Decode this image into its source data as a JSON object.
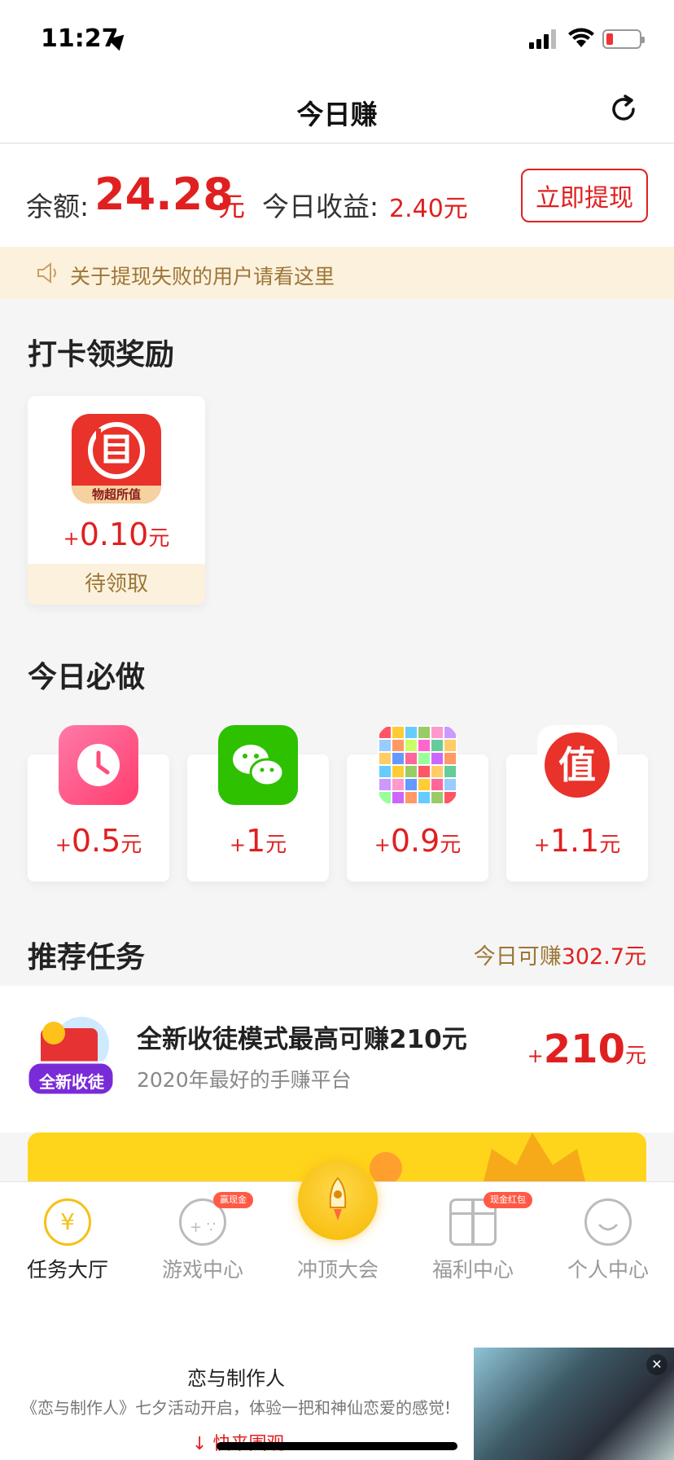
{
  "status_bar": {
    "time": "11:27"
  },
  "nav": {
    "title": "今日赚"
  },
  "balance": {
    "label": "余额:",
    "value": "24.28",
    "unit": "元",
    "today_label": "今日收益:",
    "today_value": "2.40元",
    "withdraw_label": "立即提现"
  },
  "notice": {
    "text": "关于提现失败的用户请看这里"
  },
  "checkin": {
    "title": "打卡领奖励",
    "card": {
      "badge": "物超所值",
      "plus": "+",
      "amount": "0.10",
      "unit": "元",
      "status": "待领取"
    }
  },
  "daily": {
    "title": "今日必做",
    "tasks": [
      {
        "icon": "clock-icon",
        "plus": "+",
        "amount": "0.5",
        "unit": "元"
      },
      {
        "icon": "wechat-icon",
        "plus": "+",
        "amount": "1",
        "unit": "元"
      },
      {
        "icon": "color-grid-icon",
        "plus": "+",
        "amount": "0.9",
        "unit": "元"
      },
      {
        "icon": "zhi-icon",
        "glyph": "值",
        "plus": "+",
        "amount": "1.1",
        "unit": "元"
      }
    ]
  },
  "recommend": {
    "title": "推荐任务",
    "earn_prefix": "今日可赚",
    "earn_value": "302.7元",
    "item": {
      "icon_text": "全新收徒",
      "title": "全新收徒模式最高可赚210元",
      "subtitle": "2020年最好的手赚平台",
      "plus": "+",
      "amount": "210",
      "unit": "元"
    }
  },
  "tabbar": {
    "tabs": [
      {
        "label": "任务大厅",
        "icon": "yen-icon"
      },
      {
        "label": "游戏中心",
        "icon": "gamepad-icon",
        "badge": "赢现金"
      },
      {
        "label": "冲顶大会",
        "icon": "rocket-icon"
      },
      {
        "label": "福利中心",
        "icon": "gift-icon",
        "badge": "现金红包"
      },
      {
        "label": "个人中心",
        "icon": "smile-icon"
      }
    ]
  },
  "ad": {
    "title": "恋与制作人",
    "description": "《恋与制作人》七夕活动开启，体验一把和神仙恋爱的感觉!",
    "link": "快来围观",
    "close": "✕"
  },
  "colors": {
    "accent_red": "#e02020",
    "gold_text": "#9c7636",
    "notice_bg": "#fcf1dd",
    "tab_active": "#f5c017"
  }
}
